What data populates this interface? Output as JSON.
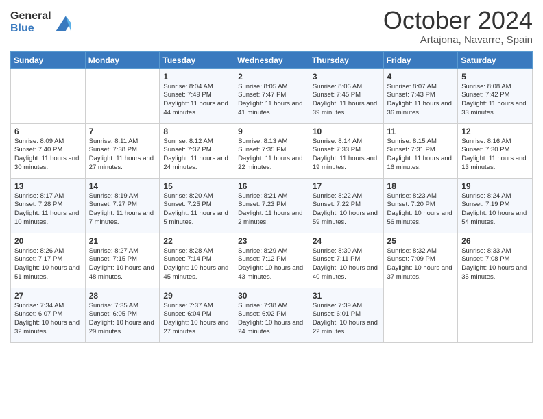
{
  "logo": {
    "general": "General",
    "blue": "Blue"
  },
  "title": "October 2024",
  "location": "Artajona, Navarre, Spain",
  "days_of_week": [
    "Sunday",
    "Monday",
    "Tuesday",
    "Wednesday",
    "Thursday",
    "Friday",
    "Saturday"
  ],
  "weeks": [
    [
      {
        "day": "",
        "info": ""
      },
      {
        "day": "",
        "info": ""
      },
      {
        "day": "1",
        "info": "Sunrise: 8:04 AM\nSunset: 7:49 PM\nDaylight: 11 hours and 44 minutes."
      },
      {
        "day": "2",
        "info": "Sunrise: 8:05 AM\nSunset: 7:47 PM\nDaylight: 11 hours and 41 minutes."
      },
      {
        "day": "3",
        "info": "Sunrise: 8:06 AM\nSunset: 7:45 PM\nDaylight: 11 hours and 39 minutes."
      },
      {
        "day": "4",
        "info": "Sunrise: 8:07 AM\nSunset: 7:43 PM\nDaylight: 11 hours and 36 minutes."
      },
      {
        "day": "5",
        "info": "Sunrise: 8:08 AM\nSunset: 7:42 PM\nDaylight: 11 hours and 33 minutes."
      }
    ],
    [
      {
        "day": "6",
        "info": "Sunrise: 8:09 AM\nSunset: 7:40 PM\nDaylight: 11 hours and 30 minutes."
      },
      {
        "day": "7",
        "info": "Sunrise: 8:11 AM\nSunset: 7:38 PM\nDaylight: 11 hours and 27 minutes."
      },
      {
        "day": "8",
        "info": "Sunrise: 8:12 AM\nSunset: 7:37 PM\nDaylight: 11 hours and 24 minutes."
      },
      {
        "day": "9",
        "info": "Sunrise: 8:13 AM\nSunset: 7:35 PM\nDaylight: 11 hours and 22 minutes."
      },
      {
        "day": "10",
        "info": "Sunrise: 8:14 AM\nSunset: 7:33 PM\nDaylight: 11 hours and 19 minutes."
      },
      {
        "day": "11",
        "info": "Sunrise: 8:15 AM\nSunset: 7:31 PM\nDaylight: 11 hours and 16 minutes."
      },
      {
        "day": "12",
        "info": "Sunrise: 8:16 AM\nSunset: 7:30 PM\nDaylight: 11 hours and 13 minutes."
      }
    ],
    [
      {
        "day": "13",
        "info": "Sunrise: 8:17 AM\nSunset: 7:28 PM\nDaylight: 11 hours and 10 minutes."
      },
      {
        "day": "14",
        "info": "Sunrise: 8:19 AM\nSunset: 7:27 PM\nDaylight: 11 hours and 7 minutes."
      },
      {
        "day": "15",
        "info": "Sunrise: 8:20 AM\nSunset: 7:25 PM\nDaylight: 11 hours and 5 minutes."
      },
      {
        "day": "16",
        "info": "Sunrise: 8:21 AM\nSunset: 7:23 PM\nDaylight: 11 hours and 2 minutes."
      },
      {
        "day": "17",
        "info": "Sunrise: 8:22 AM\nSunset: 7:22 PM\nDaylight: 10 hours and 59 minutes."
      },
      {
        "day": "18",
        "info": "Sunrise: 8:23 AM\nSunset: 7:20 PM\nDaylight: 10 hours and 56 minutes."
      },
      {
        "day": "19",
        "info": "Sunrise: 8:24 AM\nSunset: 7:19 PM\nDaylight: 10 hours and 54 minutes."
      }
    ],
    [
      {
        "day": "20",
        "info": "Sunrise: 8:26 AM\nSunset: 7:17 PM\nDaylight: 10 hours and 51 minutes."
      },
      {
        "day": "21",
        "info": "Sunrise: 8:27 AM\nSunset: 7:15 PM\nDaylight: 10 hours and 48 minutes."
      },
      {
        "day": "22",
        "info": "Sunrise: 8:28 AM\nSunset: 7:14 PM\nDaylight: 10 hours and 45 minutes."
      },
      {
        "day": "23",
        "info": "Sunrise: 8:29 AM\nSunset: 7:12 PM\nDaylight: 10 hours and 43 minutes."
      },
      {
        "day": "24",
        "info": "Sunrise: 8:30 AM\nSunset: 7:11 PM\nDaylight: 10 hours and 40 minutes."
      },
      {
        "day": "25",
        "info": "Sunrise: 8:32 AM\nSunset: 7:09 PM\nDaylight: 10 hours and 37 minutes."
      },
      {
        "day": "26",
        "info": "Sunrise: 8:33 AM\nSunset: 7:08 PM\nDaylight: 10 hours and 35 minutes."
      }
    ],
    [
      {
        "day": "27",
        "info": "Sunrise: 7:34 AM\nSunset: 6:07 PM\nDaylight: 10 hours and 32 minutes."
      },
      {
        "day": "28",
        "info": "Sunrise: 7:35 AM\nSunset: 6:05 PM\nDaylight: 10 hours and 29 minutes."
      },
      {
        "day": "29",
        "info": "Sunrise: 7:37 AM\nSunset: 6:04 PM\nDaylight: 10 hours and 27 minutes."
      },
      {
        "day": "30",
        "info": "Sunrise: 7:38 AM\nSunset: 6:02 PM\nDaylight: 10 hours and 24 minutes."
      },
      {
        "day": "31",
        "info": "Sunrise: 7:39 AM\nSunset: 6:01 PM\nDaylight: 10 hours and 22 minutes."
      },
      {
        "day": "",
        "info": ""
      },
      {
        "day": "",
        "info": ""
      }
    ]
  ]
}
